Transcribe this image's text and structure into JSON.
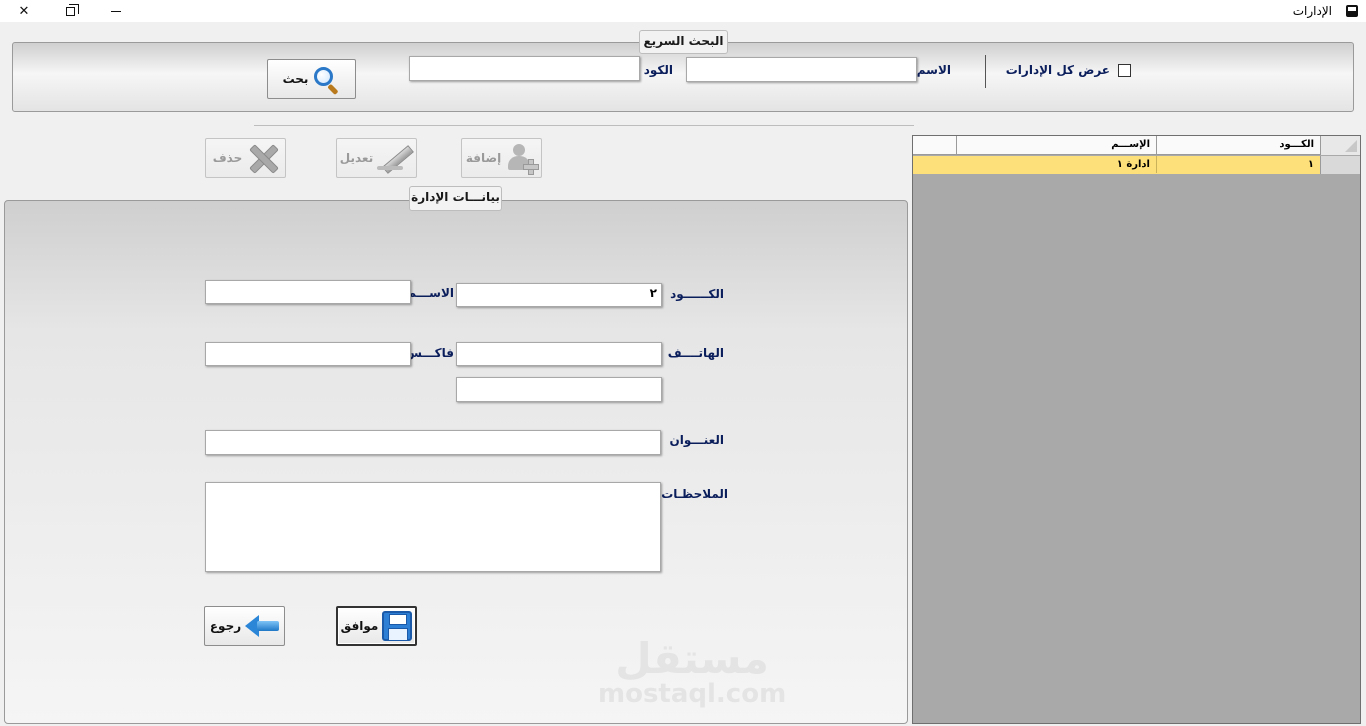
{
  "window": {
    "title": "الإدارات",
    "close_glyph": "✕"
  },
  "quick_search": {
    "title": "البحث السريع",
    "show_all_label": "عرض كل الإدارات",
    "show_all_checked": false,
    "name_label": "الاسم",
    "name_value": "",
    "code_label": "الكود",
    "code_value": "",
    "search_button": "بحث"
  },
  "toolbar": {
    "add_label": "إضافة",
    "edit_label": "تعديل",
    "delete_label": "حذف"
  },
  "form": {
    "title": "بيانـــات الإدارة",
    "code_label": "الكــــــود",
    "code_value": "٢",
    "name_label": "الاســـم",
    "name_value": "",
    "phone_label": "الهاتــــف",
    "phone_value": "",
    "fax_label": "فاكـــس",
    "fax_value": "",
    "extra_value": "",
    "address_label": "العنـــوان",
    "address_value": "",
    "notes_label": "الملاحظـات",
    "notes_value": "",
    "ok_button": "موافق",
    "back_button": "رجوع"
  },
  "grid": {
    "columns": [
      "الكـــود",
      "الإســـم"
    ],
    "rows": [
      {
        "code": "١",
        "name": "ادارة ١"
      }
    ],
    "selected_row_color": "#fde07a"
  },
  "watermark": {
    "arabic": "مستقل",
    "latin": "mostaql.com"
  }
}
